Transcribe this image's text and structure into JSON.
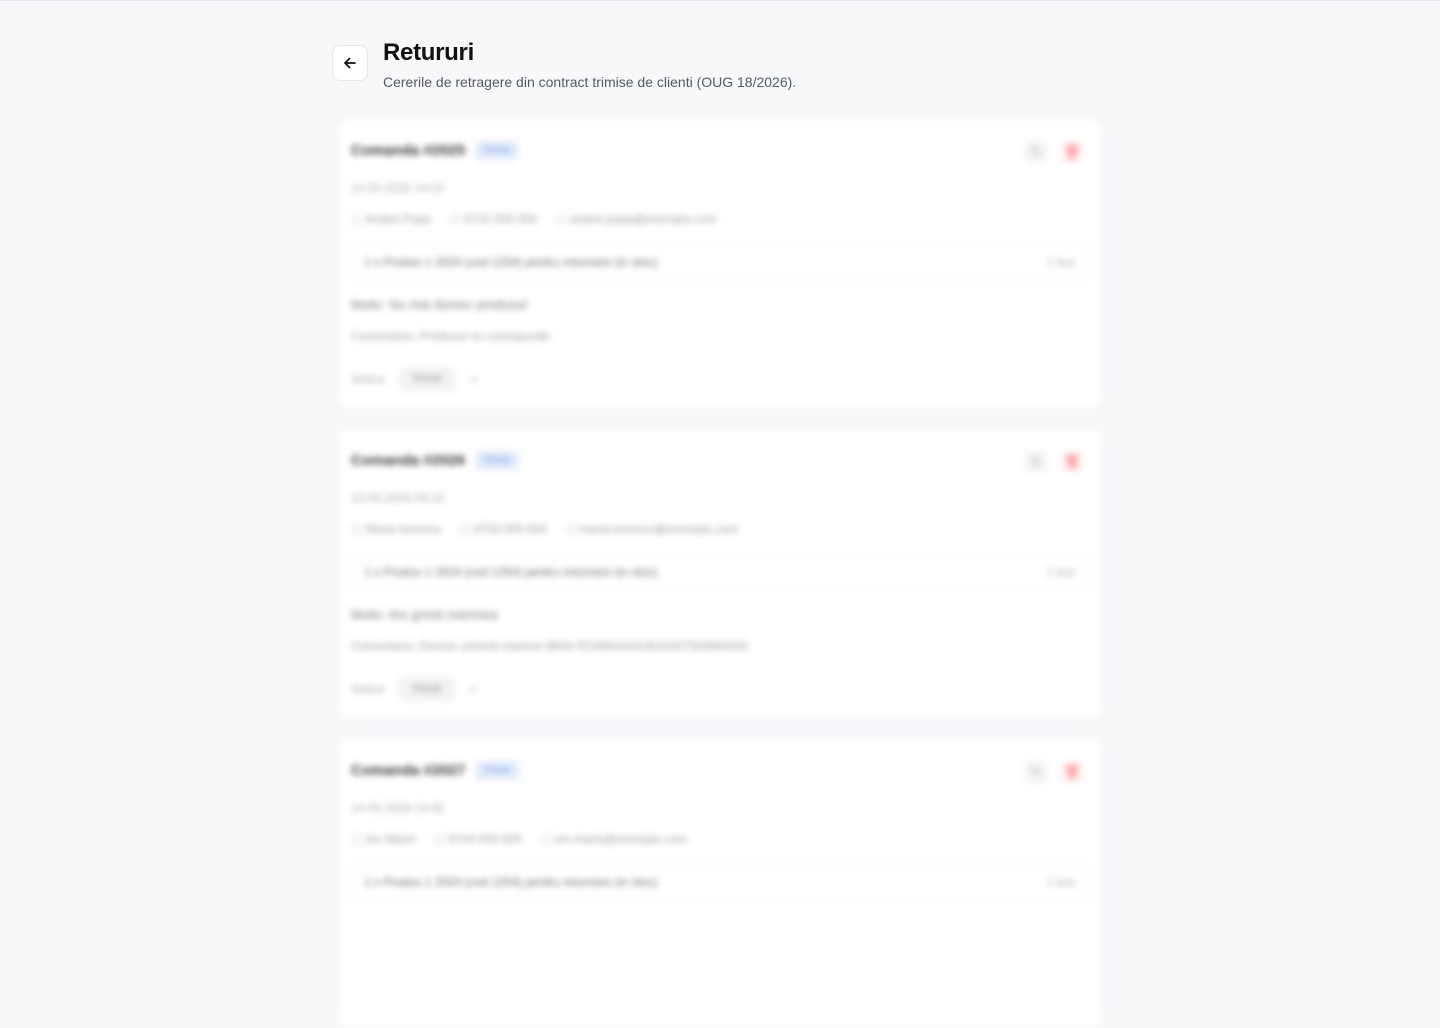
{
  "page": {
    "title": "Retururi",
    "subtitle": "Cererile de retragere din contract trimise de clienti (OUG 18/2026)."
  },
  "returns": [
    {
      "order": "Comanda #2025",
      "status": "Primit",
      "date": "12.05.2026 14:22",
      "contact": {
        "name": "Andrei Popa",
        "phone": "0722 000 000",
        "email": "andrei.popa@exemplu.com"
      },
      "product": "1 x Produs 1 2024 (cod 1254) pentru returnare (in stoc)",
      "quantity": "1 buc",
      "reason": "Motiv: Nu mai doresc produsul",
      "comment": "Comentariu: Produsul nu corespunde",
      "status_label": "Status",
      "status_value": "Primit"
    },
    {
      "order": "Comanda #2026",
      "status": "Primit",
      "date": "13.05.2026 09:10",
      "contact": {
        "name": "Maria Ionescu",
        "phone": "0733 000 000",
        "email": "maria.ionescu@exemplu.com"
      },
      "product": "1 x Produs 1 2024 (cod 1254) pentru returnare (in stoc)",
      "quantity": "1 buc",
      "reason": "Motiv: Am gresit marimea",
      "comment": "Comentariu: Doresc schimb marime IBAN RO49AAAA1B31007593840000",
      "status_label": "Status",
      "status_value": "Primit"
    },
    {
      "order": "Comanda #2027",
      "status": "Primit",
      "date": "14.05.2026 18:45",
      "contact": {
        "name": "Ion Marin",
        "phone": "0744 000 000",
        "email": "ion.marin@exemplu.com"
      },
      "product": "1 x Produs 1 2024 (cod 1254) pentru returnare (in stoc)",
      "quantity": "1 buc",
      "reason": "",
      "comment": "",
      "status_label": "",
      "status_value": ""
    }
  ],
  "icons": {
    "back": "arrow-left-icon",
    "edit": "pencil-icon",
    "delete": "trash-icon"
  },
  "colors": {
    "accent": "#6b8de8",
    "danger": "#ff6a6a",
    "background": "#f7f8fa"
  }
}
